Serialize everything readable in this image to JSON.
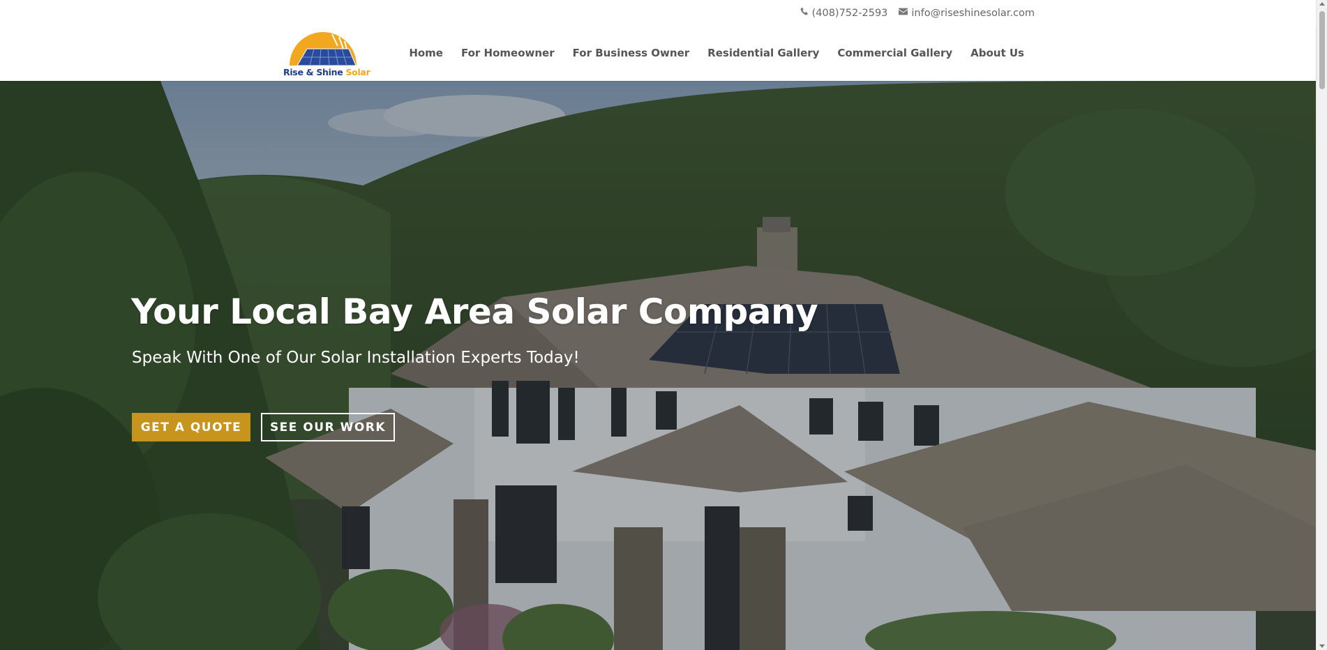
{
  "topbar": {
    "phone": "(408)752-2593",
    "email": "info@riseshinesolar.com",
    "phone_icon": "phone-icon",
    "email_icon": "envelope-icon"
  },
  "logo": {
    "text_part1": "Rise & Shine ",
    "text_part2": "Solar",
    "brand_blue": "#1f3c8a",
    "brand_yellow": "#f1a81e"
  },
  "nav": {
    "items": [
      {
        "label": "Home"
      },
      {
        "label": "For Homeowner"
      },
      {
        "label": "For Business Owner"
      },
      {
        "label": "Residential Gallery"
      },
      {
        "label": "Commercial Gallery"
      },
      {
        "label": "About Us"
      }
    ]
  },
  "hero": {
    "title": "Your Local Bay Area Solar Company",
    "subtitle": "Speak With One of Our Solar Installation Experts Today!",
    "cta_primary": "GET A QUOTE",
    "cta_secondary": "SEE OUR WORK",
    "accent_color": "#c7951d"
  }
}
